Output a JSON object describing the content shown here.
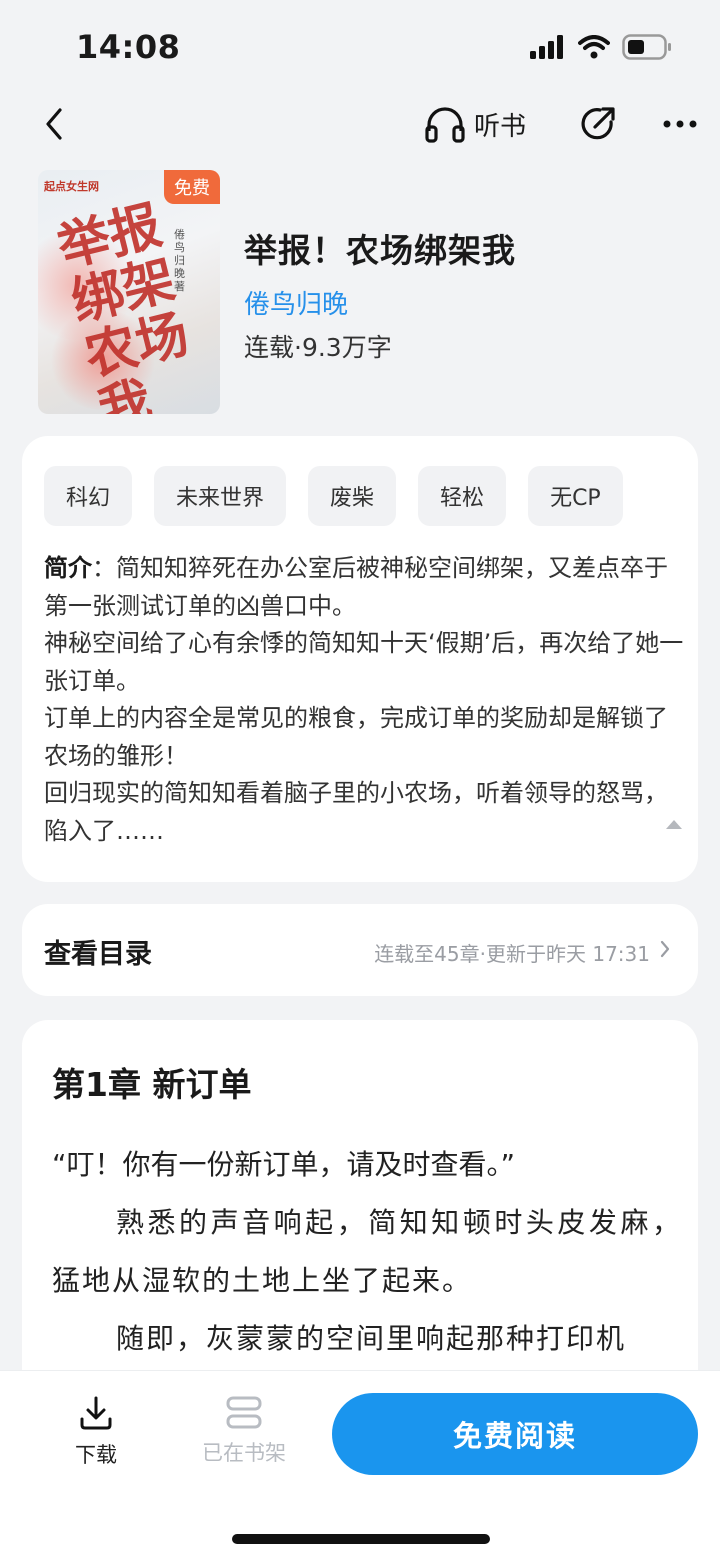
{
  "status_bar": {
    "time": "14:08"
  },
  "nav": {
    "listen_label": "听书"
  },
  "book": {
    "cover_publisher": "起点女生网",
    "cover_badge": "免费",
    "cover_title": "举报 绑架 农场我",
    "cover_author": "倦鸟归晚著",
    "title": "举报！农场绑架我",
    "author": "倦鸟归晚",
    "meta": "连载·9.3万字"
  },
  "tags": [
    "科幻",
    "未来世界",
    "废柴",
    "轻松",
    "无CP"
  ],
  "intro": {
    "label": "简介",
    "lines": [
      "：简知知猝死在办公室后被神秘空间绑架，又差点卒于第一张测试订单的凶兽口中。",
      "神秘空间给了心有余悸的简知知十天‘假期’后，再次给了她一张订单。",
      "订单上的内容全是常见的粮食，完成订单的奖励却是解锁了农场的雏形！",
      "回归现实的简知知看着脑子里的小农场，听着领导的怒骂，陷入了……"
    ]
  },
  "toc": {
    "title": "查看目录",
    "meta": "连载至45章·更新于昨天 17:31"
  },
  "chapter": {
    "title": "第1章 新订单",
    "paragraphs": [
      "“叮！你有一份新订单，请及时查看。”",
      "熟悉的声音响起，简知知顿时头皮发麻，猛地从湿软的土地上坐了起来。",
      "随即，灰蒙蒙的空间里响起那种打印机"
    ]
  },
  "bottom_bar": {
    "download_label": "下载",
    "shelf_label": "已在书架",
    "read_label": "免费阅读"
  },
  "colors": {
    "accent": "#1a95ee",
    "author_link": "#2690ea",
    "badge": "#f06a3b"
  }
}
